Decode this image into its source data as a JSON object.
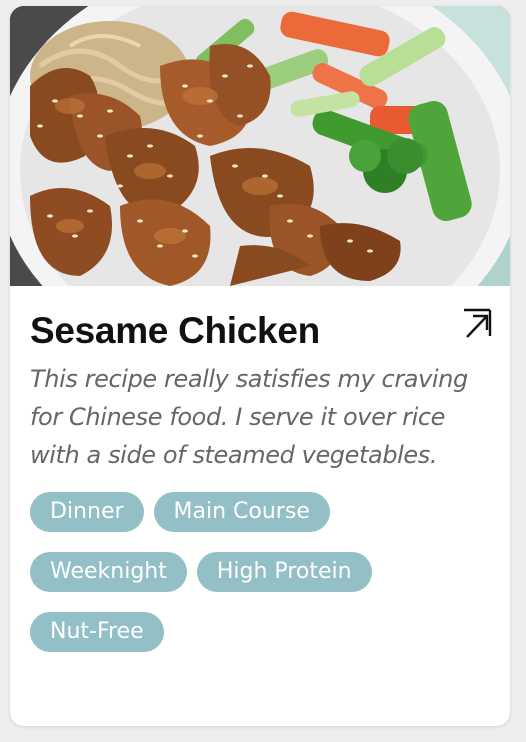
{
  "card": {
    "title": "Sesame Chicken",
    "description": "This recipe really satisfies my craving for Chinese food. I serve it over rice with a side of steamed vegetables.",
    "open_icon": "open-external-icon",
    "tags": [
      "Dinner",
      "Main Course",
      "Weeknight",
      "High Protein",
      "Nut-Free"
    ],
    "tag_color": "#93c0c7",
    "image_subject": "sesame chicken with stir-fried vegetables on a plate"
  }
}
